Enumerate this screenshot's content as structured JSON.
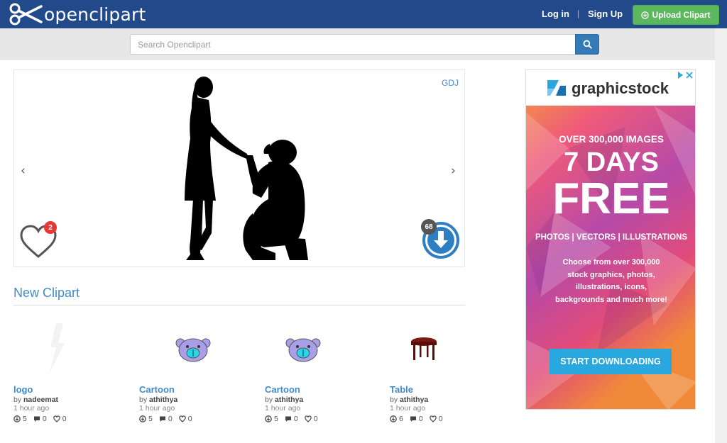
{
  "header": {
    "brand": "openclipart",
    "login": "Log in",
    "separator": "|",
    "signup": "Sign Up",
    "upload": "Upload Clipart",
    "bg_color": "#22498a",
    "upload_color": "#5cb85c"
  },
  "search": {
    "placeholder": "Search Openclipart",
    "value": ""
  },
  "featured": {
    "author": "GDJ",
    "prev": "‹",
    "next": "›",
    "favorites": "2",
    "downloads": "68"
  },
  "new_clipart": {
    "title": "New Clipart",
    "items": [
      {
        "title": "logo",
        "by_prefix": "by ",
        "author": "nadeemat",
        "ago": "1 hour ago",
        "downloads": "5",
        "comments": "0",
        "favorites": "0"
      },
      {
        "title": "Cartoon",
        "by_prefix": "by ",
        "author": "athithya",
        "ago": "1 hour ago",
        "downloads": "5",
        "comments": "0",
        "favorites": "0"
      },
      {
        "title": "Cartoon",
        "by_prefix": "by ",
        "author": "athithya",
        "ago": "1 hour ago",
        "downloads": "5",
        "comments": "0",
        "favorites": "0"
      },
      {
        "title": "Table",
        "by_prefix": "by ",
        "author": "athithya",
        "ago": "1 hour ago",
        "downloads": "6",
        "comments": "0",
        "favorites": "0"
      }
    ]
  },
  "ad": {
    "brand": "graphicstock",
    "line1": "OVER 300,000 IMAGES",
    "days": "7 DAYS",
    "free": "FREE",
    "types": "PHOTOS | VECTORS | ILLUSTRATIONS",
    "body": "Choose from over 300,000 stock graphics, photos, illustrations, icons, backgrounds and much more!",
    "cta": "START DOWNLOADING"
  },
  "icons": {
    "logo": "scissors-icon",
    "search": "magnifier-icon",
    "upload": "plus-circle-icon",
    "favorite": "heart-icon",
    "download": "download-circle-icon",
    "comment": "comment-icon"
  }
}
